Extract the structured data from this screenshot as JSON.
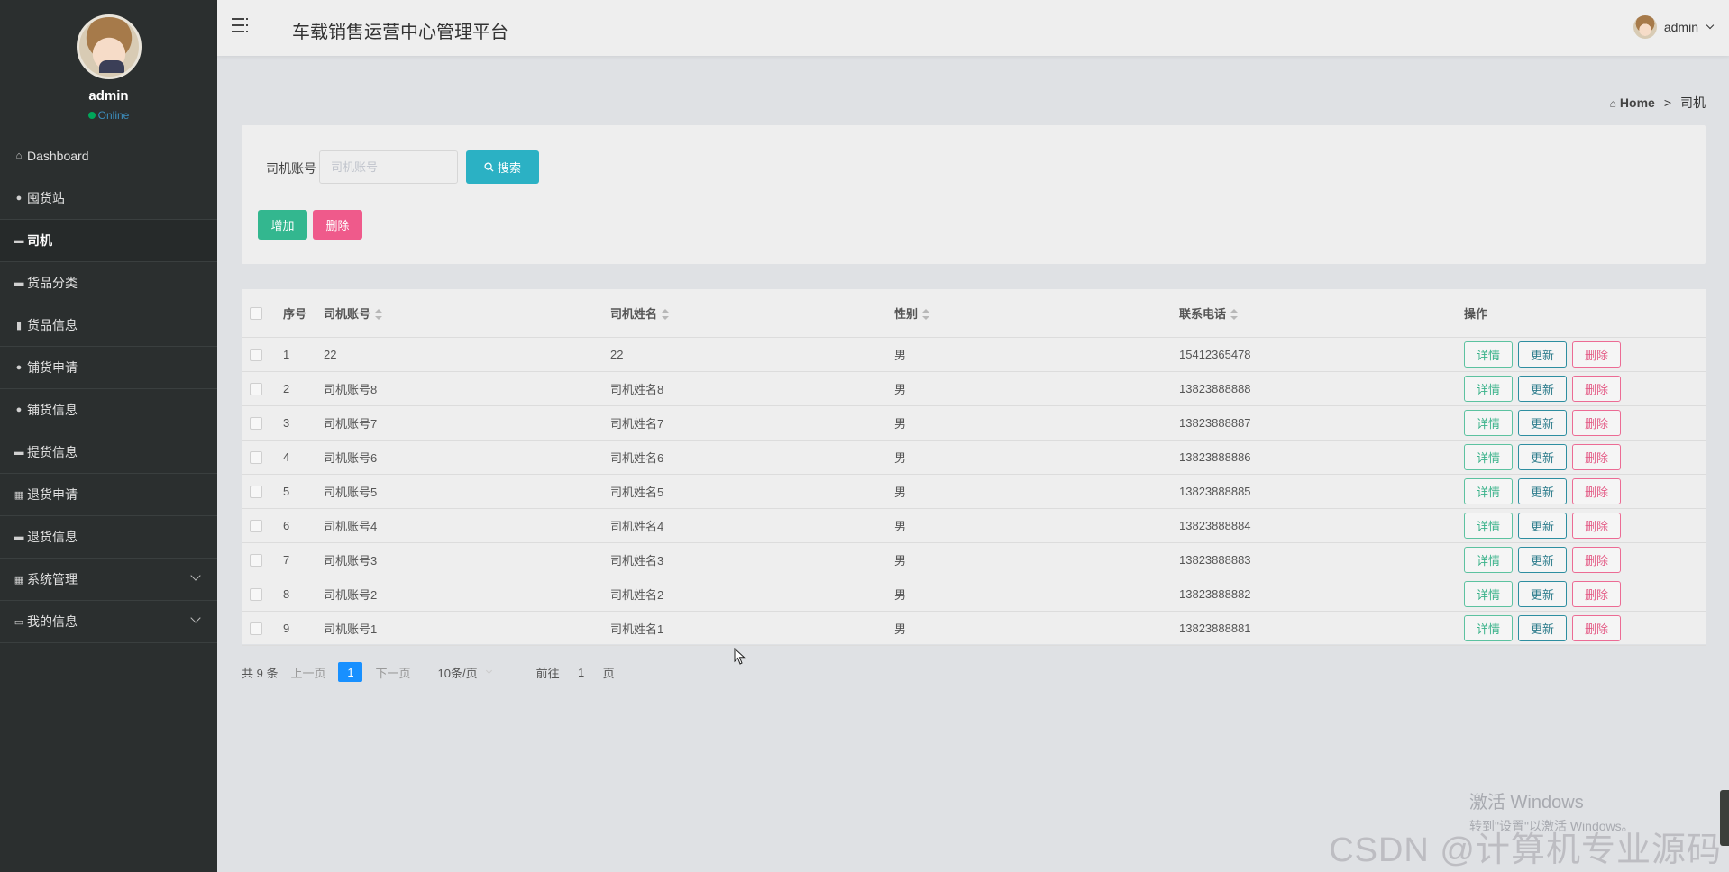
{
  "sidebar": {
    "username": "admin",
    "status": "Online",
    "items": [
      {
        "icon": "⌂",
        "label": "Dashboard",
        "active": false
      },
      {
        "icon": "●",
        "label": "囤货站",
        "active": false
      },
      {
        "icon": "▬",
        "label": "司机",
        "active": true
      },
      {
        "icon": "▬",
        "label": "货品分类",
        "active": false
      },
      {
        "icon": "▮",
        "label": "货品信息",
        "active": false
      },
      {
        "icon": "●",
        "label": "铺货申请",
        "active": false
      },
      {
        "icon": "●",
        "label": "铺货信息",
        "active": false
      },
      {
        "icon": "▬",
        "label": "提货信息",
        "active": false
      },
      {
        "icon": "▦",
        "label": "退货申请",
        "active": false
      },
      {
        "icon": "▬",
        "label": "退货信息",
        "active": false
      },
      {
        "icon": "▦",
        "label": "系统管理",
        "active": false
      },
      {
        "icon": "▭",
        "label": "我的信息",
        "active": false
      }
    ]
  },
  "header": {
    "title": "车载销售运营中心管理平台",
    "user": "admin"
  },
  "breadcrumb": {
    "home": "Home",
    "separator": ">",
    "current": "司机"
  },
  "search": {
    "label": "司机账号",
    "placeholder": "司机账号",
    "button": "搜索",
    "add_button": "增加",
    "delete_button": "删除"
  },
  "table": {
    "headers": {
      "index": "序号",
      "account": "司机账号",
      "name": "司机姓名",
      "gender": "性别",
      "phone": "联系电话",
      "actions": "操作"
    },
    "action_labels": {
      "detail": "详情",
      "update": "更新",
      "delete": "删除"
    },
    "rows": [
      {
        "index": "1",
        "account": "22",
        "name": "22",
        "gender": "男",
        "phone": "15412365478"
      },
      {
        "index": "2",
        "account": "司机账号8",
        "name": "司机姓名8",
        "gender": "男",
        "phone": "13823888888"
      },
      {
        "index": "3",
        "account": "司机账号7",
        "name": "司机姓名7",
        "gender": "男",
        "phone": "13823888887"
      },
      {
        "index": "4",
        "account": "司机账号6",
        "name": "司机姓名6",
        "gender": "男",
        "phone": "13823888886"
      },
      {
        "index": "5",
        "account": "司机账号5",
        "name": "司机姓名5",
        "gender": "男",
        "phone": "13823888885"
      },
      {
        "index": "6",
        "account": "司机账号4",
        "name": "司机姓名4",
        "gender": "男",
        "phone": "13823888884"
      },
      {
        "index": "7",
        "account": "司机账号3",
        "name": "司机姓名3",
        "gender": "男",
        "phone": "13823888883"
      },
      {
        "index": "8",
        "account": "司机账号2",
        "name": "司机姓名2",
        "gender": "男",
        "phone": "13823888882"
      },
      {
        "index": "9",
        "account": "司机账号1",
        "name": "司机姓名1",
        "gender": "男",
        "phone": "13823888881"
      }
    ]
  },
  "pagination": {
    "total": "共 9 条",
    "prev": "上一页",
    "current_page": "1",
    "next": "下一页",
    "page_size": "10条/页",
    "goto_label": "前往",
    "goto_value": "1",
    "goto_suffix": "页"
  },
  "watermarks": {
    "windows_line1": "激活 Windows",
    "windows_line2": "转到\"设置\"以激活 Windows。",
    "csdn": "CSDN @计算机专业源码"
  },
  "colors": {
    "sidebar_bg": "#2b2f2f",
    "search_btn": "#2bb1c4",
    "add_btn": "#33b78f",
    "delete_btn": "#ef5a8b",
    "page_active": "#1890ff",
    "online": "#00a65a"
  }
}
